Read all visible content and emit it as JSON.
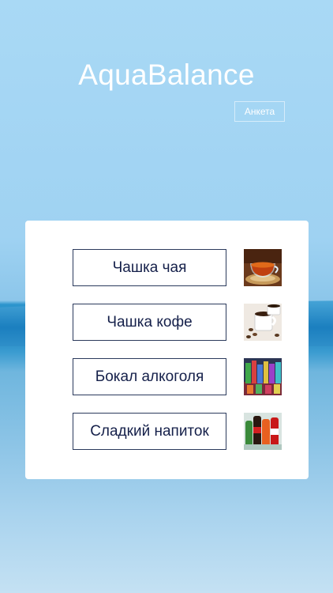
{
  "app": {
    "title": "AquaBalance"
  },
  "header": {
    "survey_label": "Анкета"
  },
  "drinks": [
    {
      "label": "Чашка чая",
      "image": "tea-cup-photo"
    },
    {
      "label": "Чашка кофе",
      "image": "coffee-cup-photo"
    },
    {
      "label": "Бокал алкоголя",
      "image": "alcohol-bottles-photo"
    },
    {
      "label": "Сладкий напиток",
      "image": "soda-bottles-photo"
    }
  ]
}
